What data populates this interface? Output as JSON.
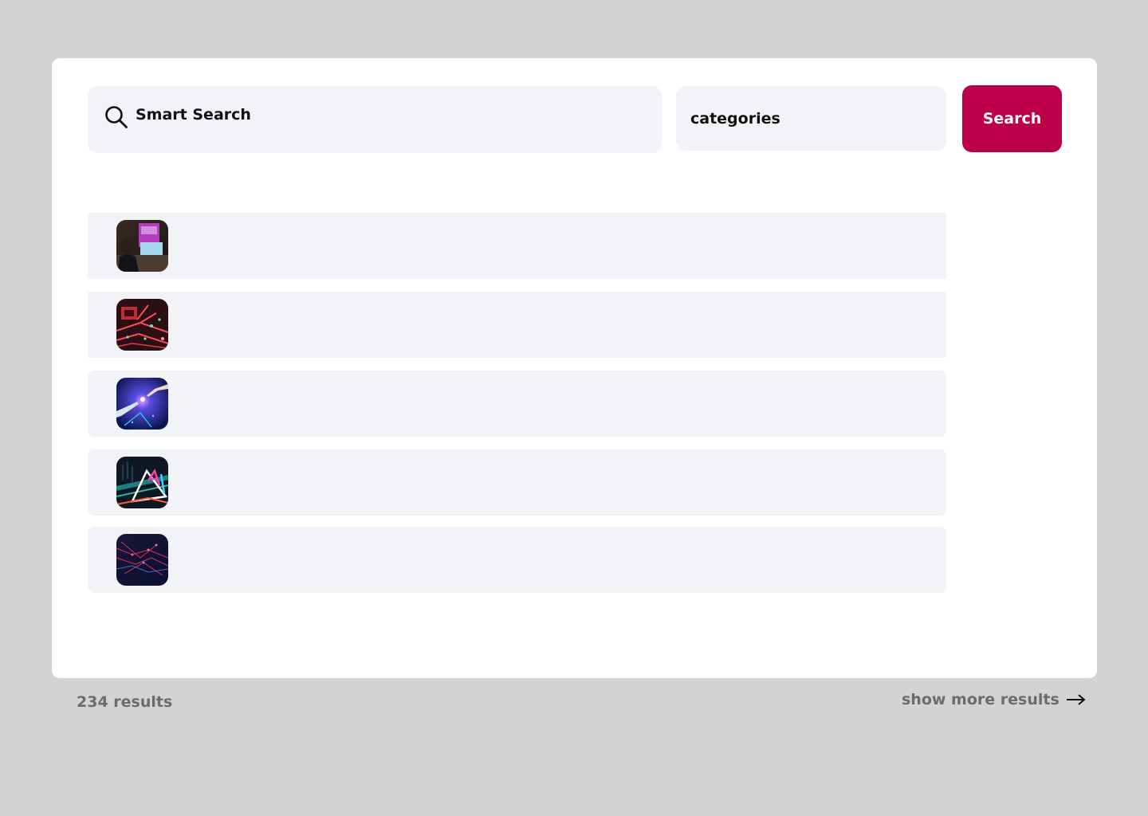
{
  "search": {
    "placeholder": "Smart Search",
    "category_label": "categories",
    "button_label": "Search"
  },
  "results": [
    {
      "thumbnail": "person-at-screen-image"
    },
    {
      "thumbnail": "circuit-board-image"
    },
    {
      "thumbnail": "robot-hand-touch-image"
    },
    {
      "thumbnail": "neon-ai-prism-image"
    },
    {
      "thumbnail": "network-lines-image"
    }
  ],
  "footer": {
    "results_count": "234 results",
    "show_more_label": "show more results"
  },
  "colors": {
    "background": "#d3d3d3",
    "card": "#ffffff",
    "field": "#f2f3f7",
    "accent": "#bc0049",
    "muted_text": "#6e6b6b"
  },
  "icons": {
    "search": "search-icon",
    "arrow": "arrow-right-icon"
  }
}
